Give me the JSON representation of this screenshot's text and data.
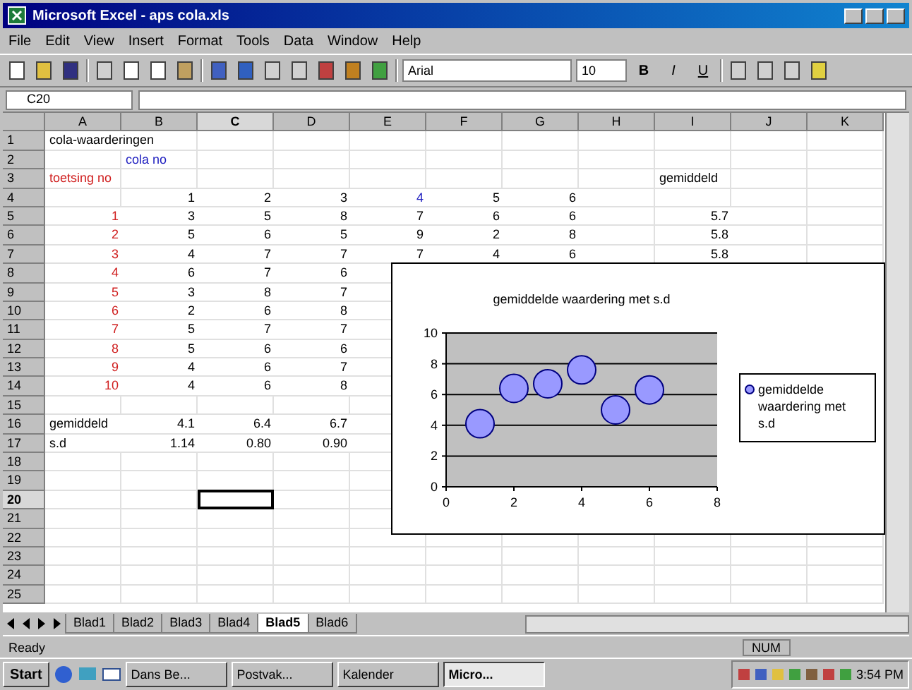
{
  "window": {
    "title": "Microsoft Excel - aps cola.xls"
  },
  "menu": [
    "File",
    "Edit",
    "View",
    "Insert",
    "Format",
    "Tools",
    "Data",
    "Window",
    "Help"
  ],
  "toolbar": {
    "font": "Arial",
    "size": "10",
    "format_buttons": [
      "B",
      "I",
      "U"
    ]
  },
  "formula_bar": {
    "name_box": "C20"
  },
  "columns": [
    "A",
    "B",
    "C",
    "D",
    "E",
    "F",
    "G",
    "H",
    "I",
    "J",
    "K"
  ],
  "rows": [
    {
      "num": "1",
      "cells": {
        "A": {
          "text": "cola-waarderingen",
          "kind": "text"
        }
      }
    },
    {
      "num": "2",
      "cells": {
        "B": {
          "text": "cola no",
          "kind": "text",
          "color": "#2020c0"
        }
      }
    },
    {
      "num": "3",
      "cells": {
        "A": {
          "text": "toetsing no",
          "kind": "text",
          "color": "#d02020"
        },
        "I": {
          "text": "gemiddeld",
          "kind": "text"
        }
      }
    },
    {
      "num": "4",
      "cells": {
        "B": {
          "text": "1",
          "kind": "number"
        },
        "C": {
          "text": "2",
          "kind": "number"
        },
        "D": {
          "text": "3",
          "kind": "number"
        },
        "E": {
          "text": "4",
          "kind": "number",
          "color": "#2020c0"
        },
        "F": {
          "text": "5",
          "kind": "number"
        },
        "G": {
          "text": "6",
          "kind": "number"
        }
      }
    },
    {
      "num": "5",
      "cells": {
        "A": {
          "text": "1",
          "kind": "number",
          "color": "#d02020"
        },
        "B": {
          "text": "3",
          "kind": "number"
        },
        "C": {
          "text": "5",
          "kind": "number"
        },
        "D": {
          "text": "8",
          "kind": "number"
        },
        "E": {
          "text": "7",
          "kind": "number"
        },
        "F": {
          "text": "6",
          "kind": "number"
        },
        "G": {
          "text": "6",
          "kind": "number"
        },
        "I": {
          "text": "5.7",
          "kind": "number"
        }
      }
    },
    {
      "num": "6",
      "cells": {
        "A": {
          "text": "2",
          "kind": "number",
          "color": "#d02020"
        },
        "B": {
          "text": "5",
          "kind": "number"
        },
        "C": {
          "text": "6",
          "kind": "number"
        },
        "D": {
          "text": "5",
          "kind": "number"
        },
        "E": {
          "text": "9",
          "kind": "number"
        },
        "F": {
          "text": "2",
          "kind": "number"
        },
        "G": {
          "text": "8",
          "kind": "number"
        },
        "I": {
          "text": "5.8",
          "kind": "number"
        }
      }
    },
    {
      "num": "7",
      "cells": {
        "A": {
          "text": "3",
          "kind": "number",
          "color": "#d02020"
        },
        "B": {
          "text": "4",
          "kind": "number"
        },
        "C": {
          "text": "7",
          "kind": "number"
        },
        "D": {
          "text": "7",
          "kind": "number"
        },
        "E": {
          "text": "7",
          "kind": "number"
        },
        "F": {
          "text": "4",
          "kind": "number"
        },
        "G": {
          "text": "6",
          "kind": "number"
        },
        "I": {
          "text": "5.8",
          "kind": "number"
        }
      }
    },
    {
      "num": "8",
      "cells": {
        "A": {
          "text": "4",
          "kind": "number",
          "color": "#d02020"
        },
        "B": {
          "text": "6",
          "kind": "number"
        },
        "C": {
          "text": "7",
          "kind": "number"
        },
        "D": {
          "text": "6",
          "kind": "number"
        }
      }
    },
    {
      "num": "9",
      "cells": {
        "A": {
          "text": "5",
          "kind": "number",
          "color": "#d02020"
        },
        "B": {
          "text": "3",
          "kind": "number"
        },
        "C": {
          "text": "8",
          "kind": "number"
        },
        "D": {
          "text": "7",
          "kind": "number"
        }
      }
    },
    {
      "num": "10",
      "cells": {
        "A": {
          "text": "6",
          "kind": "number",
          "color": "#d02020"
        },
        "B": {
          "text": "2",
          "kind": "number"
        },
        "C": {
          "text": "6",
          "kind": "number"
        },
        "D": {
          "text": "8",
          "kind": "number"
        }
      }
    },
    {
      "num": "11",
      "cells": {
        "A": {
          "text": "7",
          "kind": "number",
          "color": "#d02020"
        },
        "B": {
          "text": "5",
          "kind": "number"
        },
        "C": {
          "text": "7",
          "kind": "number"
        },
        "D": {
          "text": "7",
          "kind": "number"
        }
      }
    },
    {
      "num": "12",
      "cells": {
        "A": {
          "text": "8",
          "kind": "number",
          "color": "#d02020"
        },
        "B": {
          "text": "5",
          "kind": "number"
        },
        "C": {
          "text": "6",
          "kind": "number"
        },
        "D": {
          "text": "6",
          "kind": "number"
        }
      }
    },
    {
      "num": "13",
      "cells": {
        "A": {
          "text": "9",
          "kind": "number",
          "color": "#d02020"
        },
        "B": {
          "text": "4",
          "kind": "number"
        },
        "C": {
          "text": "6",
          "kind": "number"
        },
        "D": {
          "text": "7",
          "kind": "number"
        }
      }
    },
    {
      "num": "14",
      "cells": {
        "A": {
          "text": "10",
          "kind": "number",
          "color": "#d02020"
        },
        "B": {
          "text": "4",
          "kind": "number"
        },
        "C": {
          "text": "6",
          "kind": "number"
        },
        "D": {
          "text": "8",
          "kind": "number"
        }
      }
    },
    {
      "num": "15",
      "cells": {}
    },
    {
      "num": "16",
      "cells": {
        "A": {
          "text": "gemiddeld",
          "kind": "text"
        },
        "B": {
          "text": "4.1",
          "kind": "number"
        },
        "C": {
          "text": "6.4",
          "kind": "number"
        },
        "D": {
          "text": "6.7",
          "kind": "number"
        }
      }
    },
    {
      "num": "17",
      "cells": {
        "A": {
          "text": "s.d",
          "kind": "text"
        },
        "B": {
          "text": "1.14",
          "kind": "number"
        },
        "C": {
          "text": "0.80",
          "kind": "number"
        },
        "D": {
          "text": "0.90",
          "kind": "number"
        }
      }
    },
    {
      "num": "18",
      "cells": {}
    },
    {
      "num": "19",
      "cells": {}
    },
    {
      "num": "20",
      "cells": {
        "C": {
          "selected": true
        }
      }
    },
    {
      "num": "21",
      "cells": {}
    },
    {
      "num": "22",
      "cells": {}
    },
    {
      "num": "23",
      "cells": {}
    },
    {
      "num": "24",
      "cells": {}
    },
    {
      "num": "25",
      "cells": {}
    }
  ],
  "chart": {
    "chart_data": {
      "type": "scatter",
      "title": "gemiddelde waardering met s.d",
      "grid": true,
      "x": [
        1,
        2,
        3,
        4,
        5,
        6
      ],
      "series": [
        {
          "name": "gemiddelde waardering met s.d",
          "color": "#9999ff",
          "values": [
            4.1,
            6.4,
            6.7,
            7.6,
            5.0,
            6.3
          ]
        }
      ],
      "xlim": [
        0,
        8
      ],
      "ylim": [
        0,
        10
      ],
      "xticks": [
        {
          "value": 0,
          "label": "0"
        },
        {
          "value": 2,
          "label": "2"
        },
        {
          "value": 4,
          "label": "4"
        },
        {
          "value": 6,
          "label": "6"
        },
        {
          "value": 8,
          "label": "8"
        }
      ],
      "yticks": [
        {
          "value": 0,
          "label": "0"
        },
        {
          "value": 2,
          "label": "2"
        },
        {
          "value": 4,
          "label": "4"
        },
        {
          "value": 6,
          "label": "6"
        },
        {
          "value": 8,
          "label": "8"
        },
        {
          "value": 10,
          "label": "10"
        }
      ]
    }
  },
  "sheet_tabs": [
    {
      "label": "Blad1",
      "selected": false
    },
    {
      "label": "Blad2",
      "selected": false
    },
    {
      "label": "Blad3",
      "selected": false
    },
    {
      "label": "Blad4",
      "selected": false
    },
    {
      "label": "Blad5",
      "selected": true
    },
    {
      "label": "Blad6",
      "selected": false
    }
  ],
  "status_bar": {
    "message": "Ready",
    "indicator": "NUM"
  },
  "taskbar": {
    "start": "Start",
    "buttons": [
      {
        "label": "Dans Be...",
        "selected": false
      },
      {
        "label": "Postvak...",
        "selected": false
      },
      {
        "label": "Kalender",
        "selected": false
      },
      {
        "label": "Micro...",
        "selected": true
      }
    ],
    "clock": "3:54 PM"
  }
}
